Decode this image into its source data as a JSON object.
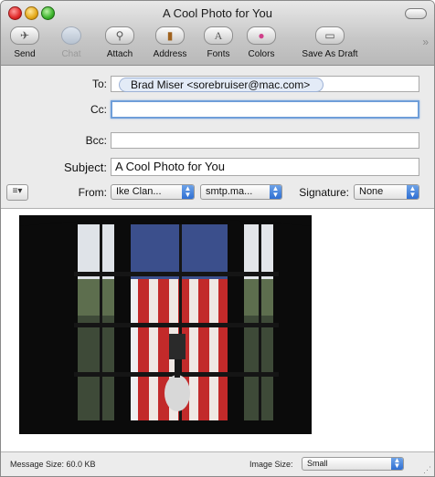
{
  "window": {
    "title": "A Cool Photo for You"
  },
  "toolbar": {
    "buttons": [
      {
        "label": "Send",
        "icon": "send-icon",
        "glyph": "✈"
      },
      {
        "label": "Chat",
        "icon": "chat-icon",
        "glyph": ""
      },
      {
        "label": "Attach",
        "icon": "paperclip-icon",
        "glyph": "⚲"
      },
      {
        "label": "Address",
        "icon": "address-book-icon",
        "glyph": "▮"
      },
      {
        "label": "Fonts",
        "icon": "fonts-icon",
        "glyph": "A"
      },
      {
        "label": "Colors",
        "icon": "color-wheel-icon",
        "glyph": "●"
      },
      {
        "label": "Save As Draft",
        "icon": "draft-icon",
        "glyph": "▭"
      }
    ],
    "overflow_glyph": "»"
  },
  "header": {
    "to_label": "To:",
    "to_recipient": "Brad  Miser  <sorebruiser@mac.com>",
    "cc_label": "Cc:",
    "cc_value": "",
    "bcc_label": "Bcc:",
    "bcc_value": "",
    "subject_label": "Subject:",
    "subject_value": "A Cool Photo for You",
    "menu_glyph": "≡▾",
    "from_label": "From:",
    "from_value": "Ike Clan...",
    "smtp_value": "smtp.ma...",
    "signature_label": "Signature:",
    "signature_value": "None"
  },
  "status": {
    "message_size": "Message Size: 60.0 KB",
    "image_size_label": "Image Size:",
    "image_size_value": "Small"
  },
  "colors": {
    "accent": "#2f6fd3",
    "focus": "#6f9ed9"
  }
}
